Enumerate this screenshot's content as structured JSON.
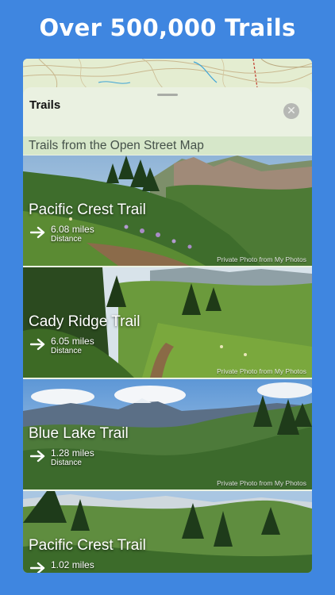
{
  "headline": "Over 500,000 Trails",
  "sheet": {
    "title": "Trails",
    "close_glyph": "✕",
    "section_header": "Trails from the Open Street Map"
  },
  "trails": [
    {
      "name": "Pacific Crest Trail",
      "distance": "6.08 miles",
      "distance_label": "Distance",
      "credit": "Private Photo from My Photos"
    },
    {
      "name": "Cady Ridge Trail",
      "distance": "6.05 miles",
      "distance_label": "Distance",
      "credit": "Private Photo from My Photos"
    },
    {
      "name": "Blue Lake Trail",
      "distance": "1.28 miles",
      "distance_label": "Distance",
      "credit": "Private Photo from My Photos"
    },
    {
      "name": "Pacific Crest Trail",
      "distance": "1.02 miles",
      "distance_label": "",
      "credit": ""
    }
  ],
  "colors": {
    "background": "#3f86e0",
    "sheet": "#eaf1e1",
    "section_header_bg": "#d6e7c9",
    "map_bg": "#e6eed3"
  },
  "icons": {
    "close": "close-icon",
    "arrow": "arrow-right-icon",
    "grabber": "grabber-handle"
  }
}
